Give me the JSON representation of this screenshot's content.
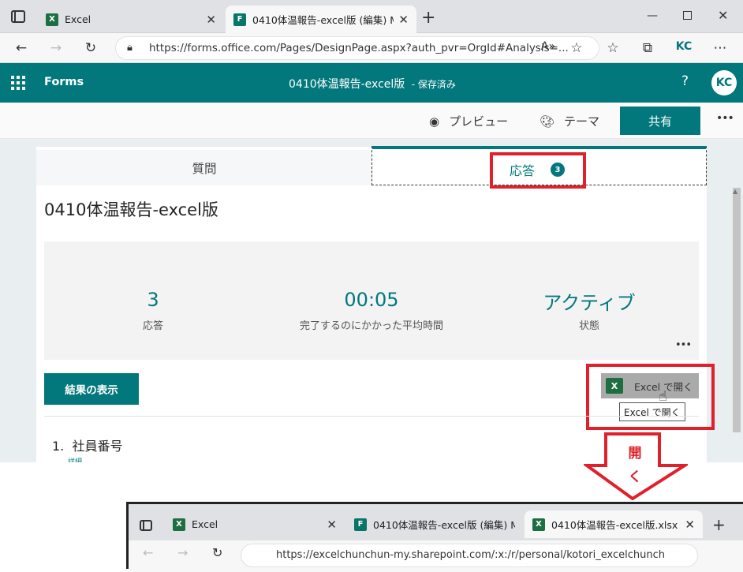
{
  "browser": {
    "tabs": [
      {
        "label": "Excel",
        "icon": "excel-icon"
      },
      {
        "label": "0410体温報告-excel版 (編集) Mic",
        "icon": "forms-icon"
      }
    ],
    "url": "https://forms.office.com/Pages/DesignPage.aspx?auth_pvr=OrgId#Analysis=...",
    "profile_initials": "KC"
  },
  "app": {
    "name": "Forms",
    "doc_title": "0410体温報告-excel版",
    "save_status": "- 保存済み",
    "help": "?",
    "avatar": "KC"
  },
  "commands": {
    "preview": "プレビュー",
    "theme": "テーマ",
    "share": "共有",
    "more": "•••"
  },
  "tabs": {
    "questions": "質問",
    "responses": "応答",
    "response_count": "3"
  },
  "form": {
    "title": "0410体温報告-excel版",
    "stats": [
      {
        "value": "3",
        "label": "応答"
      },
      {
        "value": "00:05",
        "label": "完了するのにかかった平均時間"
      },
      {
        "value": "アクティブ",
        "label": "状態"
      }
    ],
    "more": "•••",
    "view_results": "結果の表示",
    "open_in_excel": "Excel で開く",
    "tooltip": "Excel で開く",
    "question1": "1.  社員番号",
    "question1_sub": "詳細"
  },
  "annotation": {
    "arrow_text": "開く"
  },
  "lower_browser": {
    "tabs": [
      {
        "label": "Excel"
      },
      {
        "label": "0410体温報告-excel版 (編集) M"
      },
      {
        "label": "0410体温報告-excel版.xlsx"
      }
    ],
    "url": "https://excelchunchun-my.sharepoint.com/:x:/r/personal/kotori_excelchunch"
  },
  "colors": {
    "accent": "#03787c",
    "annotation_red": "#e0202a"
  }
}
